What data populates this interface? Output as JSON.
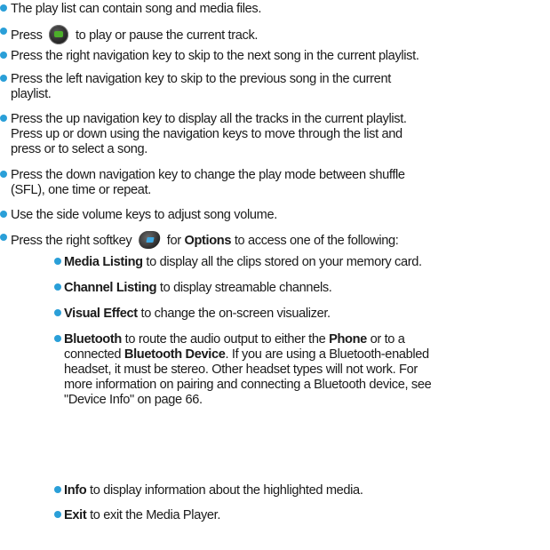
{
  "colors": {
    "bullet": "#2a9fd8",
    "text": "#1a1a1a"
  },
  "icons": {
    "ok_key": "ok-play-key-icon",
    "right_softkey": "right-softkey-icon"
  },
  "items": [
    {
      "text": "The play list can contain song and media files."
    },
    {
      "before": "Press ",
      "after": " to play or pause the current track."
    },
    {
      "text": "Press the right navigation key to skip to the next song in the current playlist."
    },
    {
      "line1": "Press the left navigation key to skip to the previous song in the current",
      "line2": "playlist."
    },
    {
      "line1": "Press the up navigation key to display all the tracks in the current playlist.",
      "line2": "Press up or down using the navigation keys to move through the list and",
      "line3": "press or to select a song."
    },
    {
      "line1": "Press the down navigation key to change the play mode between shuffle",
      "line2": "(SFL), one time or repeat."
    },
    {
      "text": "Use the side volume keys to adjust song volume."
    },
    {
      "before": "Press the right softkey ",
      "for": " for ",
      "bold": "Options",
      "after": " to access one of the following:"
    }
  ],
  "options": [
    {
      "bold": "Media Listing",
      "rest": " to display all the clips stored on your memory card."
    },
    {
      "bold": "Channel Listing",
      "rest": " to display streamable channels."
    },
    {
      "bold": "Visual Effect",
      "rest": " to change the on-screen visualizer."
    },
    {
      "bold": "Bluetooth",
      "rest1": " to route the audio output to either the ",
      "bold2": "Phone",
      "rest2": " or to a",
      "line2_pre": "connected ",
      "bold3": "Bluetooth Device",
      "line2_post": ". If you are using a Bluetooth-enabled",
      "line3": "headset, it must be stereo. Other headset types will not work. For",
      "line4": "more information on pairing and connecting a Bluetooth device, see",
      "line5": "\"Device Info\" on page 66."
    },
    {
      "bold": "Info",
      "rest": " to display information about the highlighted media."
    },
    {
      "bold": "Exit",
      "rest": " to exit the Media Player."
    }
  ]
}
